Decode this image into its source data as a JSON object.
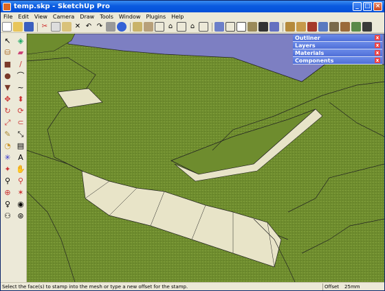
{
  "window": {
    "title": "temp.skp - SketchUp Pro"
  },
  "titlebar_buttons": {
    "minimize": "_",
    "maximize": "□",
    "close": "×"
  },
  "menu": [
    "File",
    "Edit",
    "View",
    "Camera",
    "Draw",
    "Tools",
    "Window",
    "Plugins",
    "Help"
  ],
  "toolbar_icons": [
    "new-icon",
    "open-icon",
    "save-icon",
    "cut-icon",
    "copy-icon",
    "paste-icon",
    "erase-icon",
    "undo-icon",
    "redo-icon",
    "print-icon",
    "model-info-icon",
    "paint-bucket-icon",
    "iso-view-icon",
    "top-view-icon",
    "front-view-icon",
    "right-view-icon",
    "back-view-icon",
    "left-view-icon",
    "xray-icon",
    "wireframe-icon",
    "hidden-line-icon",
    "shaded-icon",
    "textured-icon",
    "monochrome-icon",
    "get-models-icon",
    "share-model-icon",
    "share-component-icon",
    "google-earth-icon",
    "toggle-terrain-icon",
    "place-model-icon",
    "get-current-view-icon",
    "photo-texture-icon"
  ],
  "left_tool_icons": [
    "select-icon",
    "make-component-icon",
    "paint-bucket-icon",
    "eraser-icon",
    "rectangle-icon",
    "line-icon",
    "circle-icon",
    "arc-icon",
    "polygon-icon",
    "freehand-icon",
    "move-icon",
    "push-pull-icon",
    "rotate-icon",
    "follow-me-icon",
    "scale-icon",
    "offset-icon",
    "tape-measure-icon",
    "dimension-icon",
    "protractor-icon",
    "text-icon",
    "axes-icon",
    "3d-text-icon",
    "orbit-icon",
    "pan-icon",
    "zoom-icon",
    "zoom-window-icon",
    "zoom-extents-icon",
    "previous-view-icon",
    "position-camera-icon",
    "look-around-icon",
    "walk-icon",
    "section-plane-icon"
  ],
  "trays": [
    {
      "label": "Outliner"
    },
    {
      "label": "Layers"
    },
    {
      "label": "Materials"
    },
    {
      "label": "Components"
    }
  ],
  "tray_close": "x",
  "status": {
    "message": "Select the face(s) to stamp into the mesh or type a new offset for the stamp.",
    "vcb_label": "Offset",
    "vcb_value": "25mm"
  },
  "colors": {
    "terrain": "#6b8a2c",
    "water": "#7d7fc2",
    "wall": "#e8e4c8",
    "titlebar": "#0a5ae0"
  }
}
